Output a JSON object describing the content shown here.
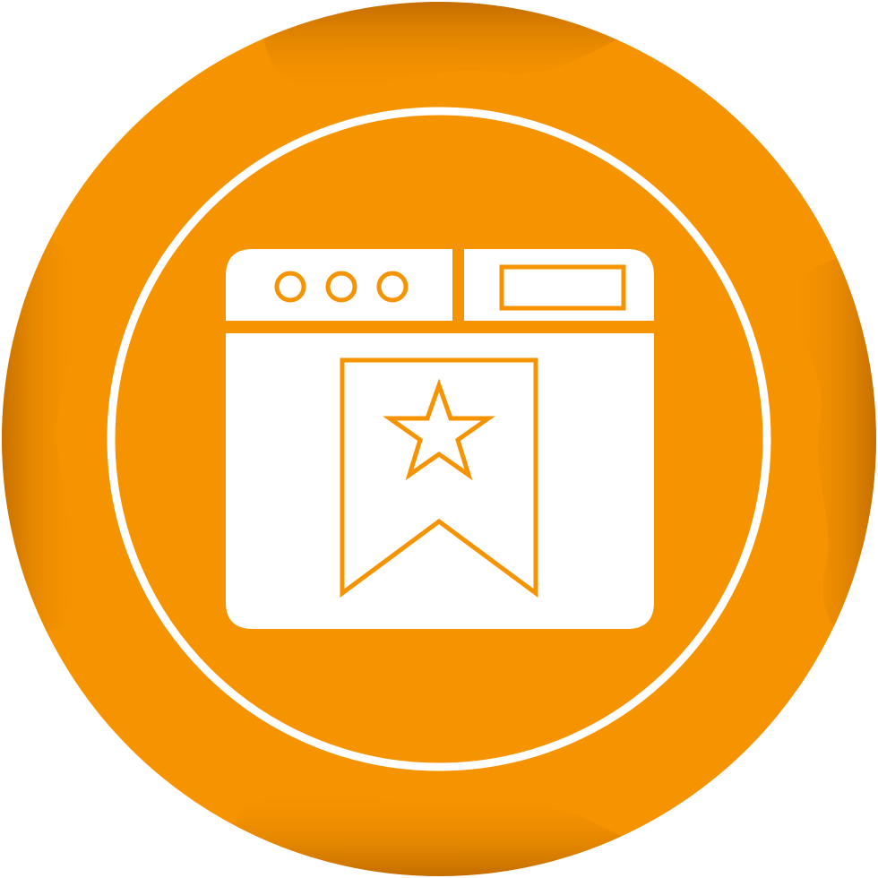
{
  "icon": {
    "name": "bookmarked-webpage-icon",
    "depicts": [
      "browser-window",
      "bookmark-ribbon",
      "star"
    ]
  },
  "colors": {
    "background": "#ffffff",
    "badge_orange": "#f59300",
    "badge_shadow": "#c46f00",
    "ring_and_glyph": "#ffffff"
  }
}
